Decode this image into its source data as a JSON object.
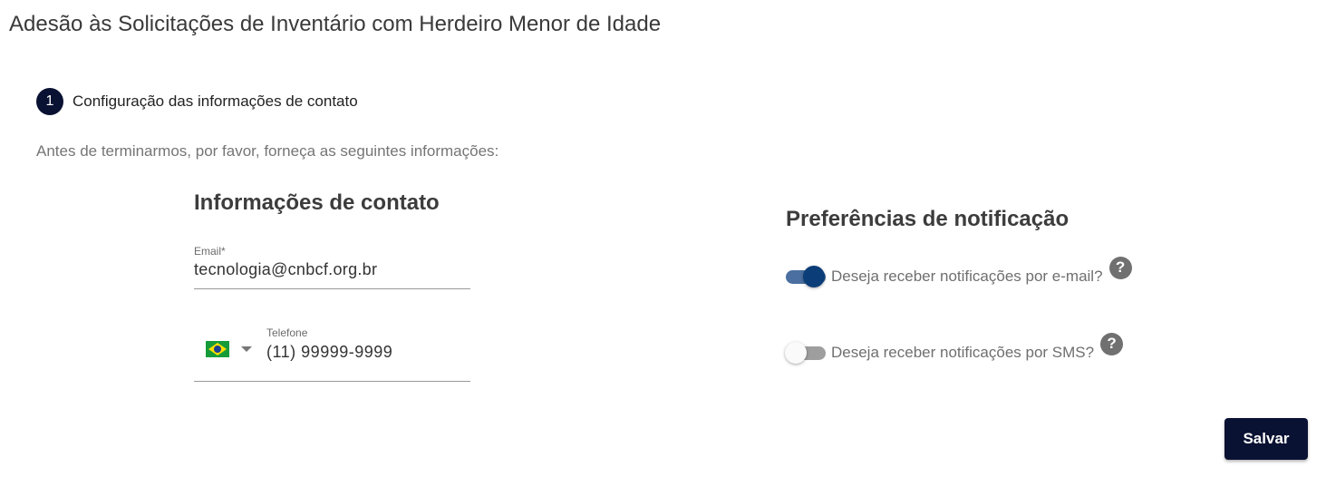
{
  "page": {
    "title": "Adesão às Solicitações de Inventário com Herdeiro Menor de Idade"
  },
  "step": {
    "number": "1",
    "label": "Configuração das informações de contato"
  },
  "intro_text": "Antes de terminarmos, por favor, forneça as seguintes informações:",
  "contact": {
    "title": "Informações de contato",
    "email_label": "Email*",
    "email_value": "tecnologia@cnbcf.org.br",
    "phone_label": "Telefone",
    "phone_country": "brazil-flag-icon",
    "phone_value": "(11) 99999-9999"
  },
  "notifications": {
    "title": "Preferências de notificação",
    "email_toggle": {
      "label": "Deseja receber notificações por e-mail?",
      "on": true
    },
    "sms_toggle": {
      "label": "Deseja receber notificações por SMS?",
      "on": false
    },
    "help_glyph": "?"
  },
  "actions": {
    "save_label": "Salvar"
  },
  "colors": {
    "primary": "#0a1233",
    "toggle_on": "#0b3d78"
  }
}
